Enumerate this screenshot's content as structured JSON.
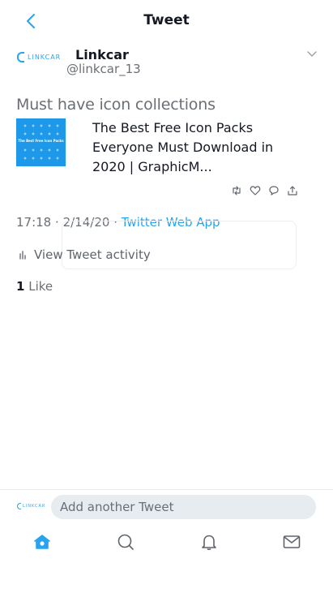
{
  "header": {
    "title": "Tweet"
  },
  "author": {
    "logo_text": "LINKCAR",
    "name": "Linkcar",
    "handle": "@linkcar_13"
  },
  "tweet": {
    "text": "Must have icon collections",
    "card": {
      "thumb_text": "The Best Free Icon Packs",
      "title": "The Best Free Icon Packs Everyone Must Download in 2020 | GraphicM..."
    },
    "time": "17:18",
    "date": "2/14/20",
    "separator": "·",
    "source": "Twitter Web App",
    "activity_label": "View Tweet activity",
    "like_count": "1",
    "like_label": "Like"
  },
  "reply": {
    "logo_text": "LINKCAR",
    "placeholder": "Add another Tweet"
  },
  "colors": {
    "accent": "#2aa3ef",
    "muted": "#6a6f76",
    "text": "#141823"
  },
  "icons": {
    "back": "chevron-left-icon",
    "more": "chevron-down-icon",
    "retweet": "retweet-icon",
    "like": "heart-icon",
    "reply": "comment-icon",
    "share": "share-icon",
    "activity": "bar-chart-icon",
    "nav": [
      "home-icon",
      "search-icon",
      "bell-icon",
      "mail-icon"
    ]
  }
}
